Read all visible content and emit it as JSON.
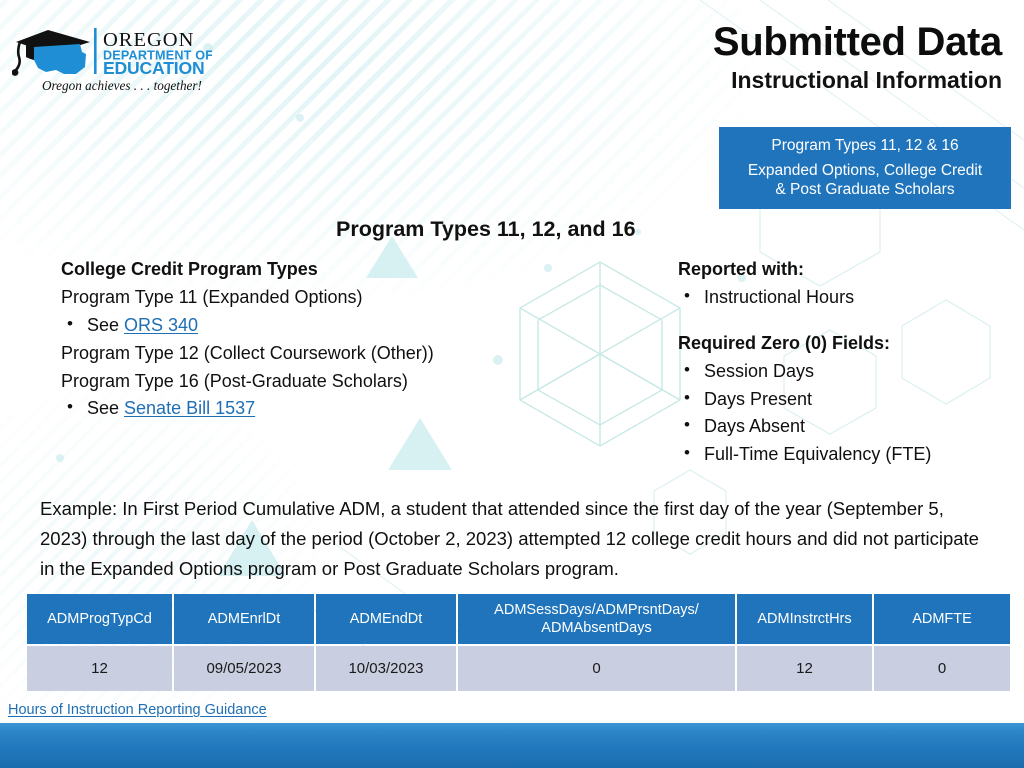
{
  "logo": {
    "org_line1": "OREGON",
    "org_line2": "DEPARTMENT OF",
    "org_line3": "EDUCATION",
    "tagline": "Oregon achieves . . . together!",
    "accent_color": "#1f8ed4"
  },
  "header": {
    "title": "Submitted Data",
    "subtitle": "Instructional Information"
  },
  "banner": {
    "line1": "Program Types 11, 12 & 16",
    "line2": "Expanded Options, College Credit",
    "line3": "& Post Graduate Scholars",
    "background_color": "#1f74bc",
    "text_color": "#ffffff"
  },
  "section_heading": "Program Types 11, 12, and 16",
  "left_column": {
    "heading": "College Credit Program Types",
    "line_type_11": "Program Type 11 (Expanded Options)",
    "bullet_see_1_prefix": "See ",
    "bullet_see_1_link": "ORS 340",
    "line_type_12": "Program Type 12 (Collect Coursework (Other))",
    "line_type_16": "Program Type 16  (Post-Graduate Scholars)",
    "bullet_see_2_prefix": "See ",
    "bullet_see_2_link": "Senate Bill 1537"
  },
  "right_column": {
    "reported_with_heading": "Reported with:",
    "reported_with_items": [
      "Instructional Hours"
    ],
    "required_zero_heading": "Required Zero (0) Fields:",
    "required_zero_items": [
      "Session Days",
      "Days Present",
      "Days Absent",
      "Full-Time Equivalency (FTE)"
    ]
  },
  "example": {
    "text": "Example: In First Period Cumulative ADM, a student that attended since the first day of the year (September 5, 2023) through the last day of the period (October 2, 2023) attempted 12 college credit hours and did not participate in the Expanded Options program or Post Graduate Scholars program."
  },
  "table": {
    "header_background": "#1f74bc",
    "row_background": "#c9cee1",
    "columns": [
      "ADMProgTypCd",
      "ADMEnrlDt",
      "ADMEndDt",
      "ADMSessDays/ADMPrsntDays/ ADMAbsentDays",
      "ADMInstrctHrs",
      "ADMFTE"
    ],
    "rows": [
      [
        "12",
        "09/05/2023",
        "10/03/2023",
        "0",
        "12",
        "0"
      ]
    ]
  },
  "footer": {
    "link_label": "Hours of Instruction Reporting Guidance",
    "link_color": "#1f6fb5",
    "bar_color": "#2077bb"
  }
}
